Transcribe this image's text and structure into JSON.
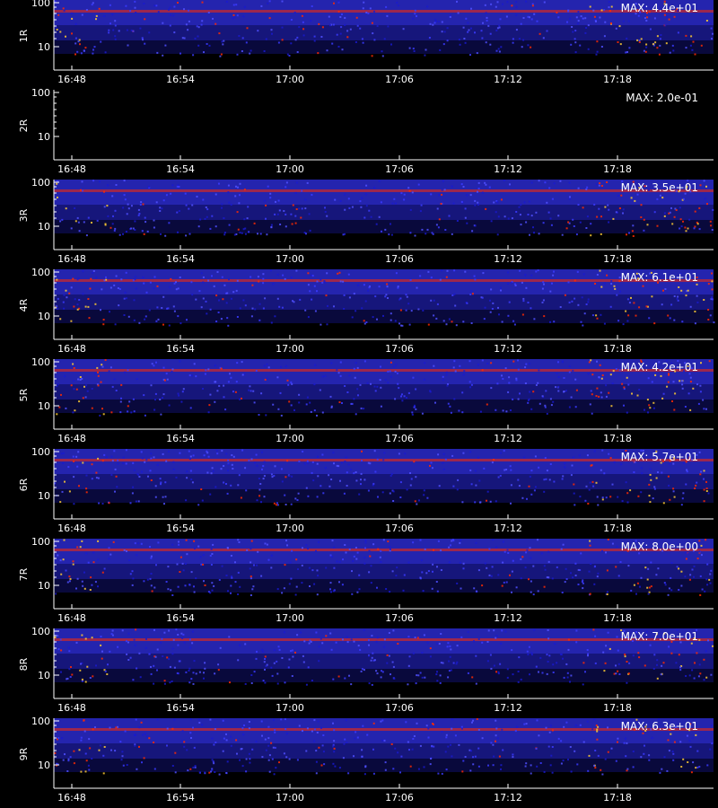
{
  "chart_data": {
    "type": "heatmap",
    "panels": [
      {
        "name": "1R",
        "max_label": "MAX: 4.4e+01"
      },
      {
        "name": "2R",
        "max_label": "MAX: 2.0e-01"
      },
      {
        "name": "3R",
        "max_label": "MAX: 3.5e+01"
      },
      {
        "name": "4R",
        "max_label": "MAX: 6.1e+01"
      },
      {
        "name": "5R",
        "max_label": "MAX: 4.2e+01"
      },
      {
        "name": "6R",
        "max_label": "MAX: 5.7e+01"
      },
      {
        "name": "7R",
        "max_label": "MAX: 8.0e+00"
      },
      {
        "name": "8R",
        "max_label": "MAX: 7.0e+01"
      },
      {
        "name": "9R",
        "max_label": "MAX: 6.3e+01"
      }
    ],
    "x_tick_labels": [
      "16:48",
      "16:54",
      "17:00",
      "17:06",
      "17:12",
      "17:18"
    ],
    "y_tick_labels": [
      "10",
      "100"
    ],
    "y_scale": "log",
    "colors": {
      "background": "#000000",
      "low": "#1a1a8c",
      "mid": "#3b3bff",
      "high": "#ff2a00"
    }
  }
}
